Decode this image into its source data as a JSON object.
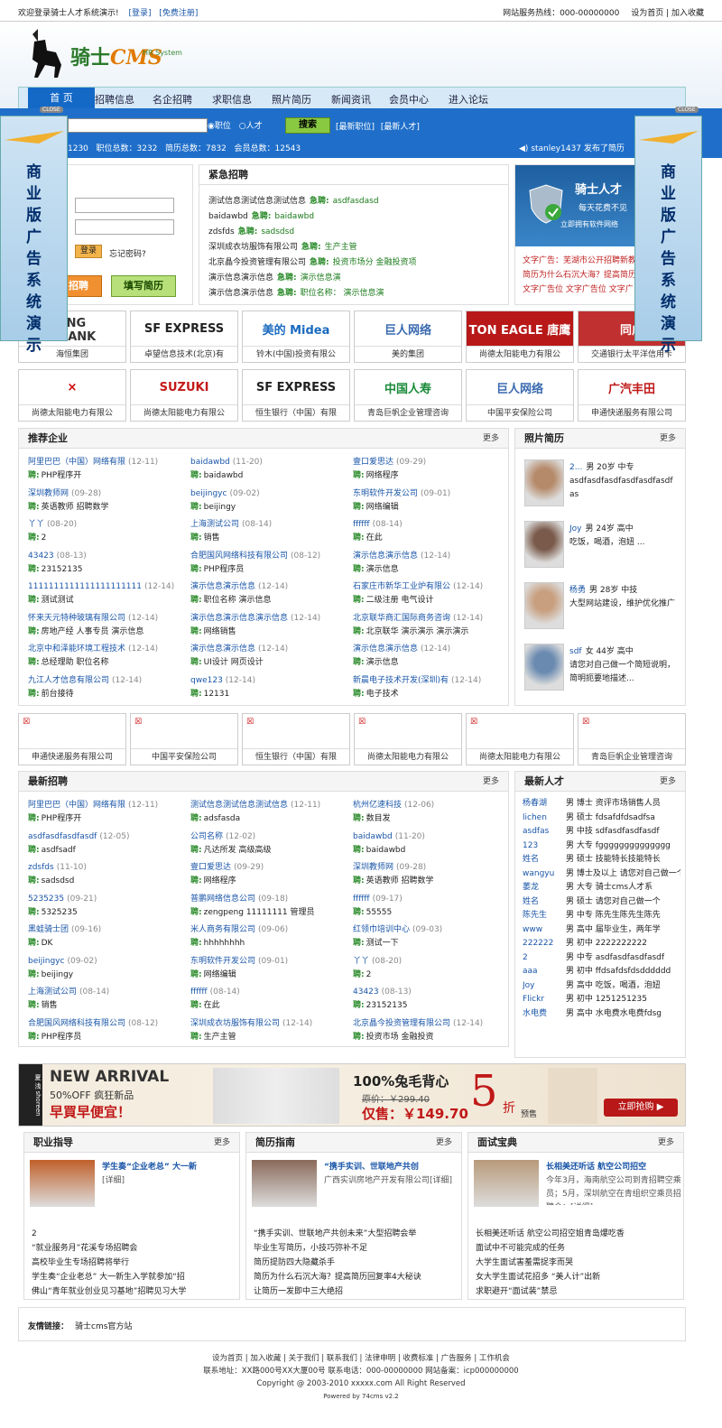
{
  "topbar": {
    "welcome": "欢迎登录骑士人才系统演示!",
    "login": "[登录]",
    "register": "[免费注册]",
    "hotline": "网站服务热线：000-00000000",
    "home": "设为首页",
    "fav": "加入收藏"
  },
  "logo": {
    "title": "骑士",
    "cms": "CMS",
    "sub": "HR System"
  },
  "nav": [
    "首  页",
    "招聘信息",
    "名企招聘",
    "求职信息",
    "照片简历",
    "新闻资讯",
    "会员中心",
    "进入论坛"
  ],
  "search": {
    "opt_job": "职位",
    "opt_talent": "人才",
    "button": "搜索",
    "latest_jobs": "[最新职位]",
    "latest_talent": "[最新人才]"
  },
  "stats": {
    "a": "1230",
    "b": "职位总数：3232",
    "c": "简历总数：7832",
    "d": "会员总数：12543"
  },
  "news_ticker": "stanley1437 发布了简历",
  "ad_side": {
    "text": "商业版广告系统演示",
    "close": "CLOSE"
  },
  "login": {
    "button": "登录",
    "forgot": "忘记密码?",
    "post": "招聘",
    "resume": "填写简历"
  },
  "urgent": {
    "title": "紧急招聘",
    "items": [
      {
        "co": "测试信息测试信息测试信息",
        "job": "asdfasdasd"
      },
      {
        "co": "baidawbd",
        "job": "baidawbd"
      },
      {
        "co": "zdsfds",
        "job": "sadsdsd"
      },
      {
        "co": "深圳成衣坊服饰有限公司",
        "job": "生产主管"
      },
      {
        "co": "北京晶今投资管理有限公司",
        "job": "投资市场分  金融投资项"
      },
      {
        "co": "演示信息演示信息",
        "job": "演示信息演"
      },
      {
        "co": "演示信息演示信息",
        "job": "职位名称：  演示信息演"
      }
    ],
    "tag": "急聘:"
  },
  "adbox": {
    "slogan": "每天花费不见",
    "call": "立即拥有软件网络",
    "brand": "骑士人才"
  },
  "textads": [
    {
      "t": "文字广告：芜湖市公开招聘新教"
    },
    {
      "t": "简历为什么石沉大海？提高简历"
    },
    {
      "t": "文字广告位  文字广告位  文字广"
    }
  ],
  "logos_row1": [
    {
      "n": "海恒集团",
      "l": "生  銀  行 NG SENG BANK"
    },
    {
      "n": "卓望信息技术(北京)有",
      "l": "SF EXPRESS"
    },
    {
      "n": "铃木(中国)投资有限公",
      "l": "美的 Midea"
    },
    {
      "n": "美的集团",
      "l": "巨人网络"
    },
    {
      "n": "尚德太阳能电力有限公",
      "l": "TON EAGLE 唐鹰"
    },
    {
      "n": "交通银行太平洋信用卡",
      "l": "同成"
    }
  ],
  "logos_row2": [
    {
      "n": "尚德太阳能电力有限公",
      "l": "×"
    },
    {
      "n": "尚德太阳能电力有限公",
      "l": "SUZUKI"
    },
    {
      "n": "恒生银行（中国）有限",
      "l": "SF EXPRESS"
    },
    {
      "n": "青岛巨帆企业管理咨询",
      "l": "中国人寿"
    },
    {
      "n": "中国平安保险公司",
      "l": "巨人网络"
    },
    {
      "n": "申通快递服务有限公司",
      "l": "广汽丰田"
    }
  ],
  "rec": {
    "title": "推荐企业",
    "more": "更多",
    "tag": "聘:",
    "cols": [
      [
        {
          "n": "阿里巴巴（中国）网络有限",
          "d": "(12-11)",
          "j": "PHP程序开"
        },
        {
          "n": "深圳教师网",
          "d": "(09-28)",
          "j": "英语教师  招聘数学"
        },
        {
          "n": "丫丫",
          "d": "(08-20)",
          "j": "2"
        },
        {
          "n": "43423",
          "d": "(08-13)",
          "j": "23152135"
        },
        {
          "n": "1111111111111111111111",
          "d": "(12-14)",
          "j": "测试测试"
        },
        {
          "n": "怀来天元特种玻璃有限公司",
          "d": "(12-14)",
          "j": "房地产经  人事专员  演示信息"
        },
        {
          "n": "北京中和泽能环境工程技术",
          "d": "(12-14)",
          "j": "总经理助  职位名称"
        },
        {
          "n": "九江人才信息有限公司",
          "d": "(12-14)",
          "j": "前台接待"
        }
      ],
      [
        {
          "n": "baidawbd",
          "d": "(11-20)",
          "j": "baidawbd"
        },
        {
          "n": "beijingyc",
          "d": "(09-02)",
          "j": "beijingy"
        },
        {
          "n": "上海测试公司",
          "d": "(08-14)",
          "j": "销售"
        },
        {
          "n": "合肥国风网络科技有限公司",
          "d": "(08-12)",
          "j": "PHP程序员"
        },
        {
          "n": "演示信息演示信息",
          "d": "(12-14)",
          "j": "职位名称  演示信息"
        },
        {
          "n": "演示信息演示信息演示信息",
          "d": "(12-14)",
          "j": "网络销售"
        },
        {
          "n": "演示信息演示信息",
          "d": "(12-14)",
          "j": "UI设计  网页设计"
        },
        {
          "n": "qwe123",
          "d": "(12-14)",
          "j": "12131"
        }
      ],
      [
        {
          "n": "壹口爱思达",
          "d": "(09-29)",
          "j": "网络程序"
        },
        {
          "n": "东明软件开发公司",
          "d": "(09-01)",
          "j": "网络编辑"
        },
        {
          "n": "ffffff",
          "d": "(08-14)",
          "j": "在此"
        },
        {
          "n": "演示信息演示信息",
          "d": "(12-14)",
          "j": "演示信息"
        },
        {
          "n": "石家庄市新华工业炉有限公",
          "d": "(12-14)",
          "j": "二级注册  电气设计"
        },
        {
          "n": "北京联华商汇国际商务咨询",
          "d": "(12-14)",
          "j": "北京联华  演示演示  演示演示"
        },
        {
          "n": "演示信息演示信息",
          "d": "(12-14)",
          "j": "演示信息"
        },
        {
          "n": "新晨电子技术开发(深圳)有",
          "d": "(12-14)",
          "j": "电子技术"
        }
      ]
    ]
  },
  "photo": {
    "title": "照片简历",
    "more": "更多",
    "items": [
      {
        "name": "2...",
        "info": "男 20岁 中专",
        "desc": "asdfasdfasdfasdfasdfasdfas"
      },
      {
        "name": "Joy",
        "info": "男 24岁 高中",
        "desc": "吃饭，喝酒，泡妞 ..."
      },
      {
        "name": "杨勇",
        "info": "男 28岁 中技",
        "desc": "大型网站建设，维护优化推广"
      },
      {
        "name": "sdf",
        "info": "女 44岁 高中",
        "desc": "请您对自己做一个简短说明，简明扼要地描述..."
      }
    ]
  },
  "logos_row3": [
    "申通快递服务有限公司",
    "中国平安保险公司",
    "恒生银行（中国）有限",
    "尚德太阳能电力有限公",
    "尚德太阳能电力有限公",
    "青岛巨帆企业管理咨询"
  ],
  "latest": {
    "title": "最新招聘",
    "more": "更多",
    "cols": [
      [
        {
          "n": "阿里巴巴（中国）网络有限",
          "d": "(12-11)",
          "j": "PHP程序开"
        },
        {
          "n": "asdfasdfasdfasdf",
          "d": "(12-05)",
          "j": "asdfsadf"
        },
        {
          "n": "zdsfds",
          "d": "(11-10)",
          "j": "sadsdsd"
        },
        {
          "n": "5235235",
          "d": "(09-21)",
          "j": "5325235"
        },
        {
          "n": "黑蛙骑士团",
          "d": "(09-16)",
          "j": "DK"
        },
        {
          "n": "beijingyc",
          "d": "(09-02)",
          "j": "beijingy"
        },
        {
          "n": "上海测试公司",
          "d": "(08-14)",
          "j": "销售"
        },
        {
          "n": "合肥国风网络科技有限公司",
          "d": "(08-12)",
          "j": "PHP程序员"
        }
      ],
      [
        {
          "n": "测试信息测试信息测试信息",
          "d": "(12-11)",
          "j": "adsfasda"
        },
        {
          "n": "公司名称",
          "d": "(12-02)",
          "j": "凡达所发  高级高级"
        },
        {
          "n": "壹口爱思达",
          "d": "(09-29)",
          "j": "网络程序"
        },
        {
          "n": "普鹏网络信息公司",
          "d": "(09-18)",
          "j": "zengpeng  11111111  管理员"
        },
        {
          "n": "米人商务有限公司",
          "d": "(09-06)",
          "j": "hhhhhhhh"
        },
        {
          "n": "东明软件开发公司",
          "d": "(09-01)",
          "j": "网络编辑"
        },
        {
          "n": "ffffff",
          "d": "(08-14)",
          "j": "在此"
        },
        {
          "n": "深圳成衣坊服饰有限公司",
          "d": "(12-14)",
          "j": "生产主管"
        }
      ],
      [
        {
          "n": "杭州亿速科技",
          "d": "(12-06)",
          "j": "数目发"
        },
        {
          "n": "baidawbd",
          "d": "(11-20)",
          "j": "baidawbd"
        },
        {
          "n": "深圳教师网",
          "d": "(09-28)",
          "j": "英语教师  招聘数学"
        },
        {
          "n": "ffffff",
          "d": "(09-17)",
          "j": "55555"
        },
        {
          "n": "红领巾培训中心",
          "d": "(09-03)",
          "j": "测试一下"
        },
        {
          "n": "丫丫",
          "d": "(08-20)",
          "j": "2"
        },
        {
          "n": "43423",
          "d": "(08-13)",
          "j": "23152135"
        },
        {
          "n": "北京晶今投资管理有限公司",
          "d": "(12-14)",
          "j": "投资市场  金融投资"
        }
      ]
    ]
  },
  "talent": {
    "title": "最新人才",
    "more": "更多",
    "items": [
      {
        "n": "杨春湖",
        "t": "男  博士  资评市场销售人员"
      },
      {
        "n": "lichen",
        "t": "男  硕士  fdsafdfdsadfsa"
      },
      {
        "n": "asdfas",
        "t": "男  中技  sdfasdfasdfasdf"
      },
      {
        "n": "123",
        "t": "男  大专  fgggggggggggggg"
      },
      {
        "n": "姓名",
        "t": "男  硕士  技能特长技能特长"
      },
      {
        "n": "wangyu",
        "t": "男  博士及以上  请您对自己做一个"
      },
      {
        "n": "萎龙",
        "t": "男  大专  骑士cms人才系"
      },
      {
        "n": "姓名",
        "t": "男  硕士  请您对自己做一个"
      },
      {
        "n": "陈先生",
        "t": "男  中专  陈先生陈先生陈先"
      },
      {
        "n": "www",
        "t": "男  高中  届毕业生，两年学"
      },
      {
        "n": "222222",
        "t": "男  初中  2222222222"
      },
      {
        "n": "2",
        "t": "男  中专  asdfasdfasdfasdf"
      },
      {
        "n": "aaa",
        "t": "男  初中  ffdsafdsfdsdddddd"
      },
      {
        "n": "Joy",
        "t": "男  高中  吃饭，喝酒，泡妞"
      },
      {
        "n": "Flickr",
        "t": "男  初中  1251251235"
      },
      {
        "n": "水电费",
        "t": "男  高中  水电费水电费fdsg"
      }
    ]
  },
  "banner": {
    "brand": "夏 浅 shoreen",
    "new": "NEW ARRIVAL",
    "off": "50%OFF 疯狂新品",
    "early": "早買早便宜！",
    "vest": "100%兔毛背心",
    "orig": "原价：￥299.40",
    "now": "仅售：￥149.70",
    "five": "5",
    "zhe": "折",
    "yushou": "预售",
    "buy": "立即抢购 ▶"
  },
  "art": [
    {
      "title": "职业指导",
      "more": "更多",
      "headline": "学生奏“企业老总”  大一新",
      "detail": "[详细]",
      "items": [
        "2",
        "“就业服务月”花溪专场招聘会",
        "高校毕业生专场招聘将举行",
        "学生奏“企业老总”  大一新生入学就参加“招",
        "佛山“青年就业创业见习基地”招聘见习大学"
      ]
    },
    {
      "title": "简历指南",
      "more": "更多",
      "headline": "“携手实训、世联地产共创",
      "detail": "广西实训房地产开发有限公司[详细]",
      "items": [
        "“携手实训、世联地产共创未来”大型招聘会举",
        "毕业生写简历，小技巧弥补不足",
        "简历提防四大隐藏杀手",
        "简历为什么石沉大海？提高简历回复率4大秘诀",
        "让简历一发即中三大绝招"
      ]
    },
    {
      "title": "面试宝典",
      "more": "更多",
      "headline": "长相美还听话  航空公司招空",
      "detail": "今年3月，海南航空公司到青招聘空乘员；5月，深圳航空在青组织空乘员招聘会；[详细]",
      "items": [
        "长相美还听话  航空公司招空姐青岛爆吃香",
        "面试中不可能完成的任务",
        "大学生面试害羞需捉李而哭",
        "女大学生面试花招多  “美人计”出新",
        "求职避开“面试装”禁忌"
      ]
    }
  ],
  "friend": {
    "label": "友情链接：",
    "link": "骑士cms官方站"
  },
  "footer": {
    "l1": "设为首页 | 加入收藏  | 关于我们 | 联系我们 | 法律申明 | 收费标准 | 广告服务 | 工作机会",
    "l2": "联系地址：XX路000号XX大厦00号  联系电话：000-00000000  网站备案：icp000000000",
    "l3": "Copyright @ 2003-2010 xxxxx.com All Right Reserved",
    "l4": "Powered by 74cms v2.2"
  }
}
